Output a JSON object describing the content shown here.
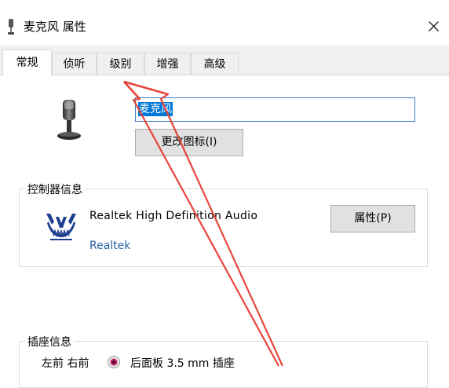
{
  "window": {
    "title": "麦克风 属性"
  },
  "tabs": [
    {
      "label": "常规",
      "active": true
    },
    {
      "label": "侦听",
      "active": false
    },
    {
      "label": "级别",
      "active": false
    },
    {
      "label": "增强",
      "active": false
    },
    {
      "label": "高级",
      "active": false
    }
  ],
  "general": {
    "device_name_value": "麦克风",
    "change_icon_button": "更改图标(I)"
  },
  "controller": {
    "group_title": "控制器信息",
    "device_name": "Realtek High Definition Audio",
    "vendor_link": "Realtek",
    "properties_button": "属性(P)"
  },
  "jack": {
    "group_title": "插座信息",
    "position": "左前 右前",
    "description": "后面板 3.5 mm 插座"
  },
  "colors": {
    "selection": "#0078d7",
    "link": "#2a62a6",
    "annotation_arrow": "#e8463c",
    "jack_dot": "#c71f6f"
  }
}
